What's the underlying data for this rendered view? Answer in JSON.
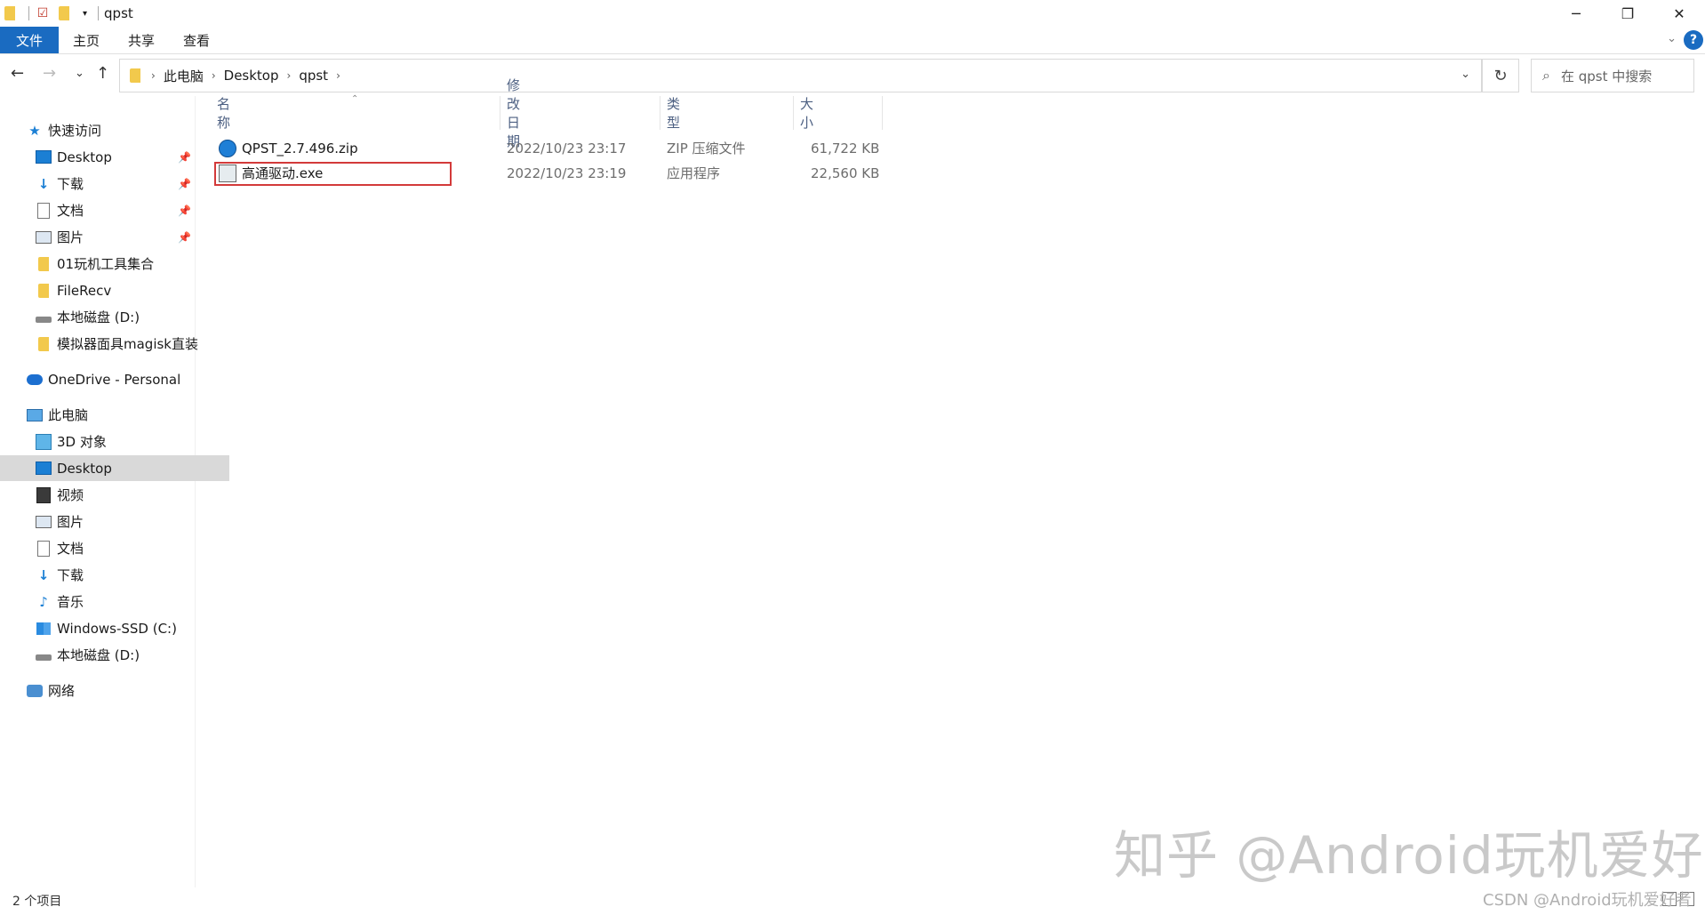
{
  "window": {
    "title": "qpst",
    "controls": {
      "minimize": "─",
      "maximize": "❐",
      "close": "✕"
    }
  },
  "ribbon": {
    "tabs": [
      "文件",
      "主页",
      "共享",
      "查看"
    ],
    "help": "?"
  },
  "navigation": {
    "back": "←",
    "forward": "→",
    "recent": "⌄",
    "up": "↑",
    "breadcrumb": [
      "此电脑",
      "Desktop",
      "qpst"
    ],
    "refresh": "↻",
    "search_placeholder": "在 qpst 中搜索"
  },
  "sidebar": {
    "quick_access": "快速访问",
    "quick_items": [
      {
        "label": "Desktop",
        "icon": "desktop-icon",
        "pinned": true
      },
      {
        "label": "下载",
        "icon": "download-icon",
        "pinned": true
      },
      {
        "label": "文档",
        "icon": "document-icon",
        "pinned": true
      },
      {
        "label": "图片",
        "icon": "picture-icon",
        "pinned": true
      },
      {
        "label": "01玩机工具集合",
        "icon": "folder-icon",
        "pinned": false
      },
      {
        "label": "FileRecv",
        "icon": "folder-icon",
        "pinned": false
      },
      {
        "label": "本地磁盘 (D:)",
        "icon": "drive-icon",
        "pinned": false
      },
      {
        "label": "模拟器面具magisk直装",
        "icon": "folder-icon",
        "pinned": false
      }
    ],
    "onedrive": "OneDrive - Personal",
    "this_pc": "此电脑",
    "pc_items": [
      {
        "label": "3D 对象",
        "icon": "3d-objects-icon"
      },
      {
        "label": "Desktop",
        "icon": "desktop-icon"
      },
      {
        "label": "视频",
        "icon": "video-icon"
      },
      {
        "label": "图片",
        "icon": "picture-icon"
      },
      {
        "label": "文档",
        "icon": "document-icon"
      },
      {
        "label": "下载",
        "icon": "download-icon"
      },
      {
        "label": "音乐",
        "icon": "music-icon"
      },
      {
        "label": "Windows-SSD (C:)",
        "icon": "windows-drive-icon"
      },
      {
        "label": "本地磁盘 (D:)",
        "icon": "drive-icon"
      }
    ],
    "network": "网络",
    "selected": "Desktop"
  },
  "file_list": {
    "columns": [
      "名称",
      "修改日期",
      "类型",
      "大小"
    ],
    "rows": [
      {
        "name": "QPST_2.7.496.zip",
        "date": "2022/10/23 23:17",
        "type": "ZIP 压缩文件",
        "size": "61,722 KB",
        "icon": "zip-icon"
      },
      {
        "name": "高通驱动.exe",
        "date": "2022/10/23 23:19",
        "type": "应用程序",
        "size": "22,560 KB",
        "icon": "exe-icon"
      }
    ]
  },
  "status": {
    "item_count": "2 个项目"
  },
  "watermark": "知乎 @Android玩机爱好",
  "credit": "CSDN @Android玩机爱好者"
}
